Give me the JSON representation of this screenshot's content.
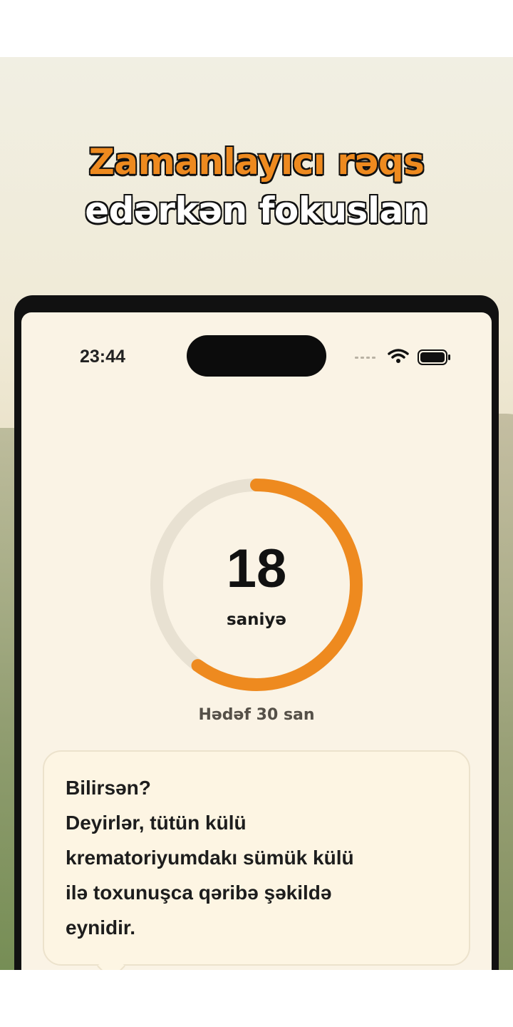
{
  "headline": {
    "line1": "Zamanlayıcı rəqs",
    "line2": "edərkən fokuslan"
  },
  "status_bar": {
    "time": "23:44",
    "icons": [
      "signal-dots-icon",
      "wifi-icon",
      "battery-icon"
    ]
  },
  "timer": {
    "count": "18",
    "unit_label": "saniyə",
    "goal_label": "Hədəf 30 san",
    "progress_fraction": 0.6
  },
  "tip": {
    "lines": [
      "Bilirsən?",
      "Deyirlər, tütün külü",
      "krematoriyumdakı sümük külü",
      "ilə toxunuşca qəribə şəkildə",
      "eynidir."
    ]
  },
  "colors": {
    "accent": "#ee8a1f",
    "ring_track": "#e8e1d2",
    "screen_background": "#faf3e5",
    "bubble_background": "#fdf5e3"
  },
  "mascot": {
    "icon": "cat-mascot-icon"
  }
}
